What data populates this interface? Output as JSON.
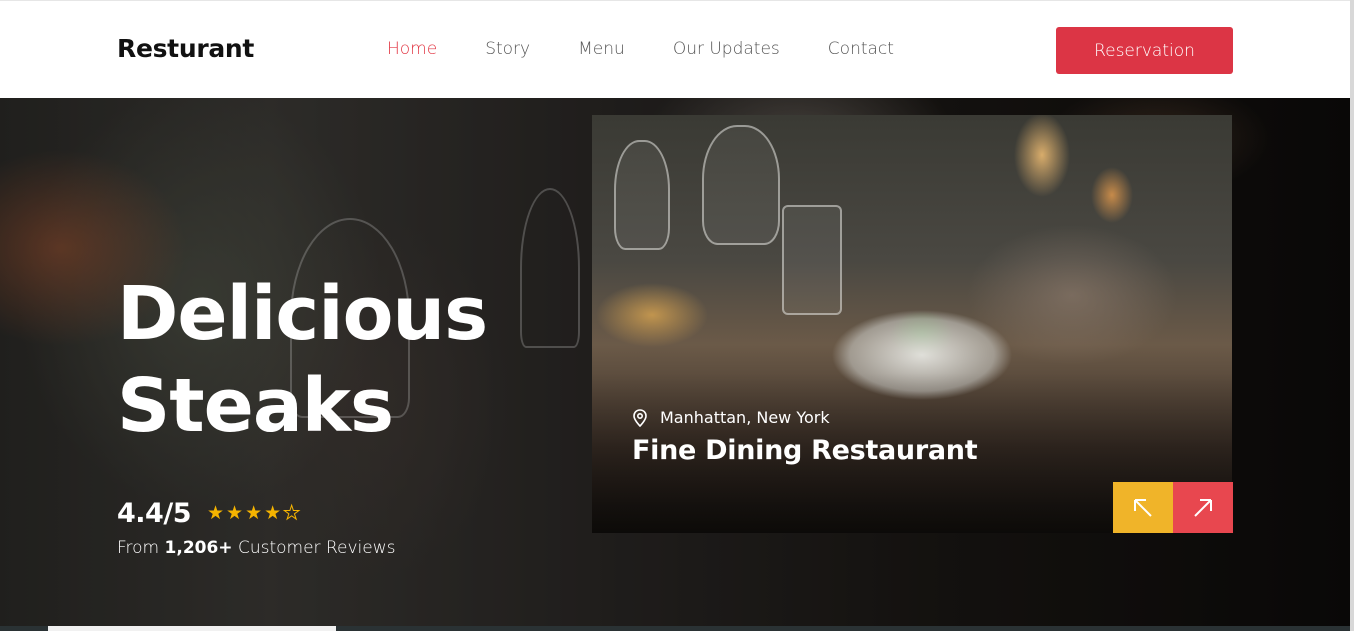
{
  "nav": {
    "brand": "Resturant",
    "links": [
      {
        "label": "Home",
        "active": true
      },
      {
        "label": "Story",
        "active": false
      },
      {
        "label": "Menu",
        "active": false
      },
      {
        "label": "Our Updates",
        "active": false
      },
      {
        "label": "Contact",
        "active": false
      }
    ],
    "cta_label": "Reservation"
  },
  "hero": {
    "title_line1": "Delicious",
    "title_line2": "Steaks",
    "rating": "4.4/5",
    "stars_filled": 4,
    "stars_total": 5,
    "reviews_prefix": "From",
    "reviews_count": "1,206+",
    "reviews_suffix": "Customer Reviews"
  },
  "card": {
    "location": "Manhattan, New York",
    "title": "Fine Dining Restaurant",
    "prev_icon": "arrow-up-left-icon",
    "next_icon": "arrow-up-right-icon"
  },
  "colors": {
    "accent": "#dc3545",
    "star": "#f5b400",
    "prev_button": "#f0b429",
    "next_button": "#e8474f"
  }
}
